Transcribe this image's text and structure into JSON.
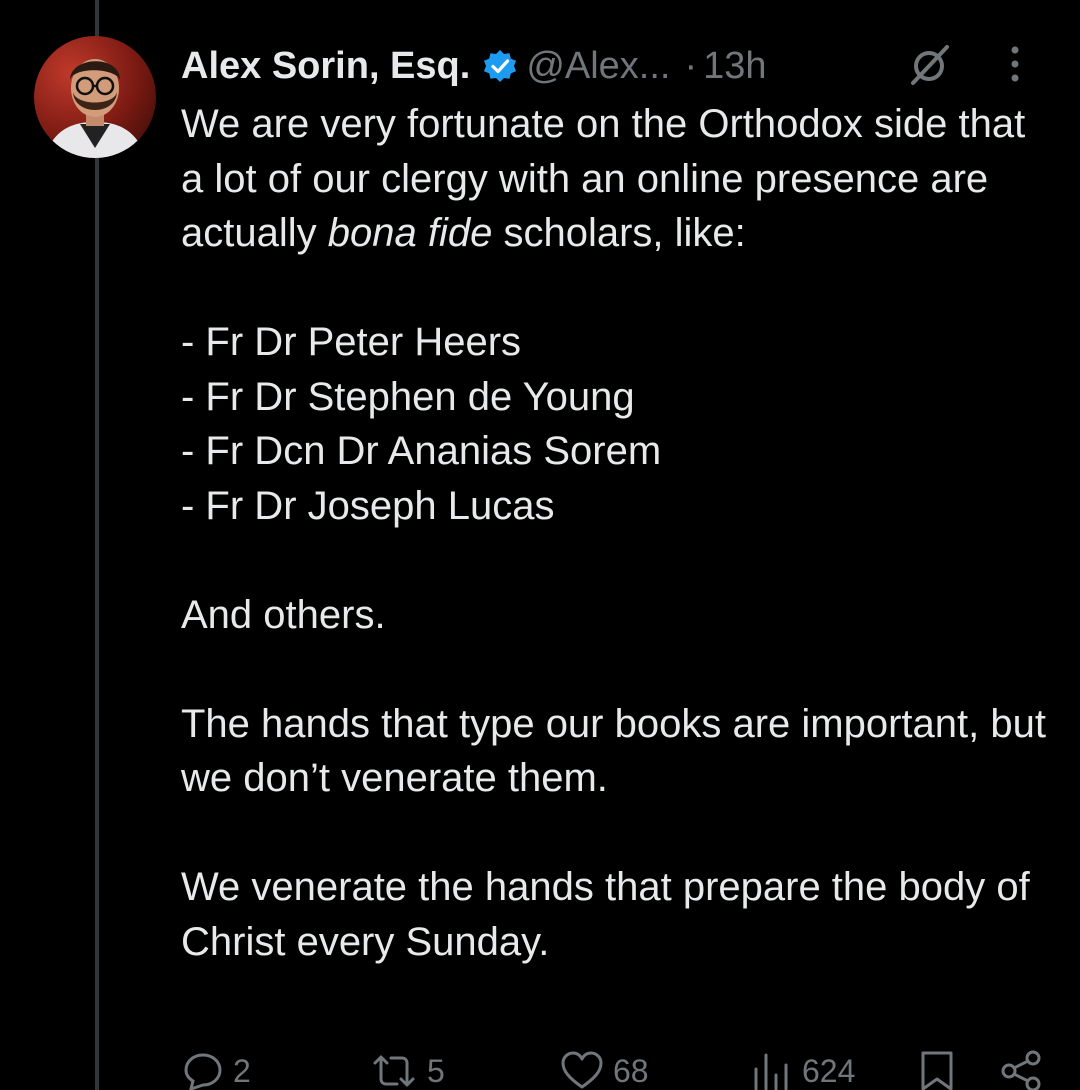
{
  "author": {
    "name": "Alex Sorin, Esq.",
    "handle": "@Alex...",
    "dot": "·",
    "time": "13h",
    "verified": true
  },
  "icons": {
    "verified": "verified-badge-icon",
    "grok": "grok-icon",
    "more": "more-vertical-icon",
    "reply": "reply-icon",
    "retweet": "retweet-icon",
    "like": "heart-icon",
    "views": "views-icon",
    "bookmark": "bookmark-icon",
    "share": "share-icon"
  },
  "colors": {
    "background": "#000000",
    "text": "#e7e9ea",
    "muted": "#71767b",
    "verified": "#1d9bf0",
    "thread_line": "#333639"
  },
  "body": {
    "intro_before_em": "We are very fortunate on the Orthodox side that a lot of our clergy with an online presence are actually ",
    "intro_em": "bona fide",
    "intro_after_em": " scholars, like:",
    "list": [
      "- Fr Dr Peter Heers",
      "- Fr Dr Stephen de Young",
      "- Fr Dcn Dr Ananias Sorem",
      "- Fr Dr Joseph Lucas"
    ],
    "others": "And others.",
    "para2": "The hands that type our books are important, but we don’t venerate them.",
    "para3": "We venerate the hands that prepare the body of Christ every Sunday."
  },
  "stats": {
    "replies": "2",
    "retweets": "5",
    "likes": "68",
    "views": "624"
  }
}
